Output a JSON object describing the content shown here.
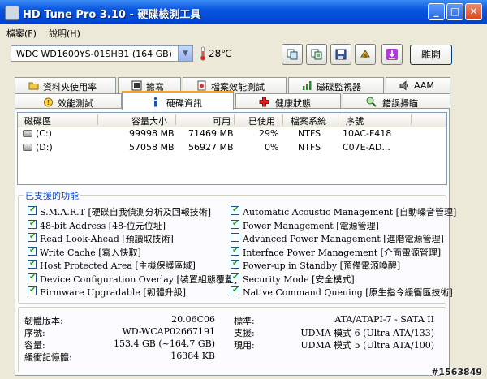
{
  "window": {
    "title": "HD Tune Pro 3.10 - 硬碟檢測工具"
  },
  "menu": [
    "檔案(F)",
    "說明(H)"
  ],
  "toolbar": {
    "drive": "WDC WD1600YS-01SHB1 (164 GB)",
    "temperature": "28℃",
    "exit_label": "離開"
  },
  "tabs_row1": [
    "資料夾使用率",
    "擦寫",
    "檔案效能測試",
    "磁碟監視器",
    "AAM"
  ],
  "tabs_row2": [
    "效能測試",
    "硬碟資訊",
    "健康狀態",
    "錯誤掃瞄"
  ],
  "active_tab": "硬碟資訊",
  "partitions": {
    "columns": [
      "磁碟區",
      "容量大小",
      "可用",
      "已使用",
      "檔案系統",
      "序號"
    ],
    "rows": [
      [
        "(C:)",
        "99998 MB",
        "71469 MB",
        "29%",
        "NTFS",
        "10AC-F418"
      ],
      [
        "(D:)",
        "57058 MB",
        "56927 MB",
        "0%",
        "NTFS",
        "C07E-AD..."
      ]
    ]
  },
  "features": {
    "title": "已支援的功能",
    "left": [
      {
        "label": "S.M.A.R.T [硬碟自我偵測分析及回報技術]",
        "checked": true
      },
      {
        "label": "48-bit Address [48-位元位址]",
        "checked": true
      },
      {
        "label": "Read Look-Ahead [預讀取技術]",
        "checked": true
      },
      {
        "label": "Write Cache [寫入快取]",
        "checked": true
      },
      {
        "label": "Host Protected Area [主機保護區域]",
        "checked": true
      },
      {
        "label": "Device Configuration Overlay [裝置組態覆蓋]",
        "checked": true
      },
      {
        "label": "Firmware Upgradable [韌體升級]",
        "checked": true
      }
    ],
    "right": [
      {
        "label": "Automatic Acoustic Management [自動噪音管理]",
        "checked": true
      },
      {
        "label": "Power Management [電源管理]",
        "checked": true
      },
      {
        "label": "Advanced Power Management [進階電源管理]",
        "checked": false
      },
      {
        "label": "Interface Power Management [介面電源管理]",
        "checked": true
      },
      {
        "label": "Power-up in Standby [預備電源喚醒]",
        "checked": true
      },
      {
        "label": "Security Mode [安全模式]",
        "checked": true
      },
      {
        "label": "Native Command Queuing [原生指令緩衝區技術]",
        "checked": true
      }
    ]
  },
  "info": {
    "left": [
      {
        "label": "韌體版本:",
        "value": "20.06C06"
      },
      {
        "label": "序號:",
        "value": "WD-WCAP02667191"
      },
      {
        "label": "容量:",
        "value": "153.4 GB (~164.7 GB)"
      },
      {
        "label": "緩衝記憶體:",
        "value": "16384 KB"
      }
    ],
    "right": [
      {
        "label": "標準:",
        "value": "ATA/ATAPI-7 - SATA II"
      },
      {
        "label": "支援:",
        "value": "UDMA 模式 6 (Ultra ATA/133)"
      },
      {
        "label": "現用:",
        "value": "UDMA 模式 5 (Ultra ATA/100)"
      }
    ]
  },
  "watermark": "#1563849",
  "colors": {
    "title_bar": "#0A55E0",
    "check": "#21A121",
    "accent_tab": "#F8A524",
    "group_title": "#0046D5"
  },
  "icons": {
    "tabs_row1": [
      "folder-icon",
      "eraser-icon",
      "file-benchmark-icon",
      "monitor-chart-icon",
      "speaker-icon"
    ],
    "tabs_row2": [
      "benchmark-icon",
      "info-icon",
      "health-cross-icon",
      "scan-magnifier-icon"
    ],
    "toolbar": [
      "copy-icon",
      "copy-text-icon",
      "save-icon",
      "options-icon",
      "download-icon"
    ]
  }
}
